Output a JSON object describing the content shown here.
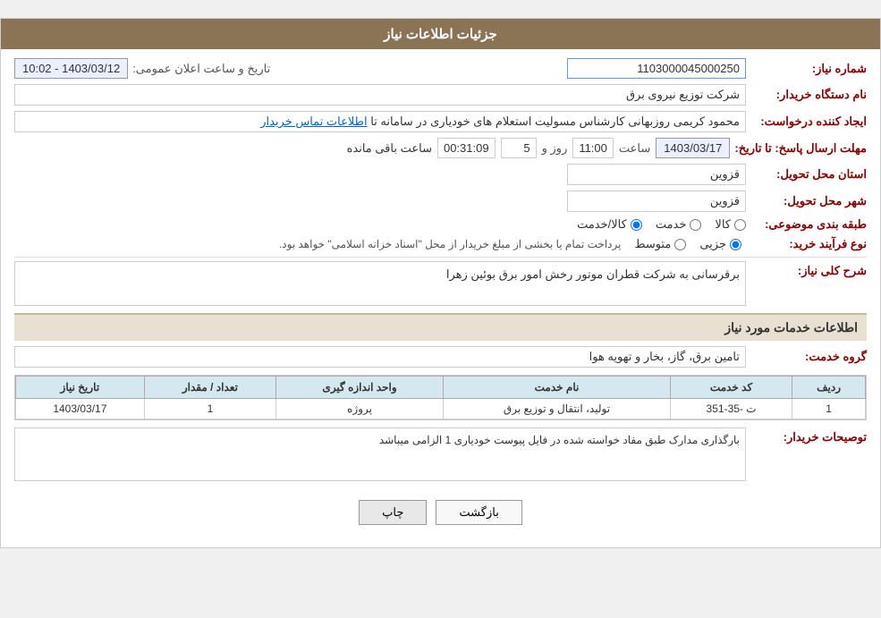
{
  "header": {
    "title": "جزئیات اطلاعات نیاز"
  },
  "fields": {
    "shomara_niaz_label": "شماره نیاز:",
    "shomara_niaz_value": "1103000045000250",
    "naam_dastgah_label": "نام دستگاه خریدار:",
    "naam_dastgah_value": "شرکت توزیع نیروی برق",
    "ijad_label": "ایجاد کننده درخواست:",
    "ijad_value": "محمود کریمی روزبهانی کارشناس  مسولیت استعلام های خودیاری در سامانه تا",
    "ijad_link": "اطلاعات تماس خریدار",
    "mohlet_label": "مهلت ارسال پاسخ: تا تاریخ:",
    "mohlet_date": "1403/03/17",
    "mohlet_time_label": "ساعت",
    "mohlet_time": "11:00",
    "mohlet_day_label": "روز و",
    "mohlet_days": "5",
    "mohlet_remaining_label": "ساعت باقی مانده",
    "mohlet_remaining": "00:31:09",
    "ostan_label": "استان محل تحویل:",
    "ostan_value": "قزوین",
    "shahr_label": "شهر محل تحویل:",
    "shahr_value": "قزوین",
    "tabaghe_label": "طبقه بندی موضوعی:",
    "type_label": "نوع فرآیند خرید:",
    "announce_label": "تاریخ و ساعت اعلان عمومی:",
    "announce_value": "1403/03/12 - 10:02",
    "radio_kala": "کالا",
    "radio_khadamat": "خدمت",
    "radio_kala_khadamat": "کالا/خدمت",
    "radio_jazvi": "جزیی",
    "radio_motawaset": "متوسط",
    "process_desc": "پرداخت تمام یا بخشی از مبلغ خریدار از محل \"اسناد خزانه اسلامی\" خواهد بود."
  },
  "sharh_niaz_section": {
    "title": "شرح کلی نیاز:",
    "value": "برقرسانی به شرکت قطران موتور رخش امور برق بوئین زهرا"
  },
  "khadamat_section": {
    "title": "اطلاعات خدمات مورد نیاز",
    "gorohe_khadamat_label": "گروه خدمت:",
    "gorohe_khadamat_value": "تامین برق، گاز، بخار و تهویه هوا"
  },
  "table": {
    "headers": [
      "ردیف",
      "کد خدمت",
      "نام خدمت",
      "واحد اندازه گیری",
      "تعداد / مقدار",
      "تاریخ نیاز"
    ],
    "rows": [
      {
        "radif": "1",
        "kod_khadamat": "ت -35-351",
        "naam_khadamat": "تولید، انتقال و توزیع برق",
        "vahad": "پروژه",
        "tedad": "1",
        "tarikh": "1403/03/17"
      }
    ]
  },
  "buyer_notes": {
    "label": "توصیحات خریدار:",
    "value": "بارگذاری مدارک طبق مفاد خواسته شده در فایل پیوست خودیاری 1 الزامی میباشد"
  },
  "buttons": {
    "print_label": "چاپ",
    "back_label": "بازگشت"
  }
}
